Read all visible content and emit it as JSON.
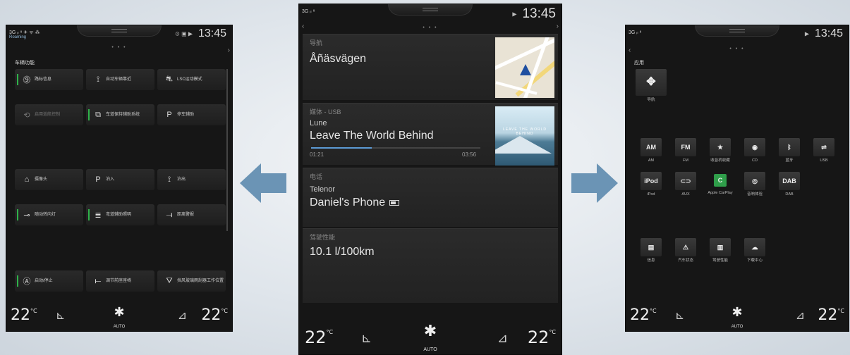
{
  "colors": {
    "accent_green": "#2fb34a",
    "arrow_blue": "#6b94b5",
    "progress_blue": "#5c9bd5"
  },
  "left_screen": {
    "status": {
      "signal": "3G ᵢₗ ⁸ ✈ ᯤ ⁂",
      "sub": "Roaming",
      "icons": "⊙ ▣ ▶",
      "clock": "13:45"
    },
    "page_dots": "• • •",
    "title": "车辆功能",
    "functions": [
      {
        "icon": "⓽",
        "label": "路标信息",
        "active": true,
        "dim": false
      },
      {
        "icon": "⟟",
        "label": "自动车辆靠近",
        "active": false,
        "dim": false
      },
      {
        "icon": "⛐",
        "label": "LSC运动模式",
        "active": false,
        "dim": false
      },
      {
        "icon": "⟲",
        "label": "启用巡航控制",
        "active": false,
        "dim": true
      },
      {
        "icon": "⧉",
        "label": "车道保持辅助系统",
        "active": true,
        "dim": false
      },
      {
        "icon": "P",
        "label": "停车辅助",
        "active": false,
        "dim": false
      },
      {
        "icon": "⌂",
        "label": "摄像头",
        "active": false,
        "dim": false
      },
      {
        "icon": "P",
        "label": "泊入",
        "active": false,
        "dim": false
      },
      {
        "icon": "⟟",
        "label": "泊出",
        "active": false,
        "dim": false
      },
      {
        "icon": "⊸",
        "label": "随动转向灯",
        "active": true,
        "dim": false
      },
      {
        "icon": "≣",
        "label": "弯道辅助照明",
        "active": true,
        "dim": false
      },
      {
        "icon": "⟞",
        "label": "距离警报",
        "active": false,
        "dim": false
      },
      {
        "icon": "Ⓐ",
        "label": "启动/停止",
        "active": true,
        "dim": false
      },
      {
        "icon": "⟝",
        "label": "调节前座座椅",
        "active": false,
        "dim": false
      },
      {
        "icon": "⛛",
        "label": "挡风玻璃雨刮器工作位置",
        "active": false,
        "dim": false
      }
    ],
    "climate": {
      "left_temp": "22",
      "right_temp": "22",
      "unit": "°C",
      "auto": "AUTO",
      "seat_left": "⊾",
      "seat_right": "⊿",
      "fan": "✱"
    }
  },
  "center_screen": {
    "status": {
      "signal": "3G ᵢₗ ⁸",
      "icons": "▶",
      "clock": "13:45"
    },
    "page_dots": "• • •",
    "navigation": {
      "header": "导航",
      "street": "Åñäsvägen"
    },
    "media": {
      "header": "媒体 - USB",
      "artist": "Lune",
      "track": "Leave The World Behind",
      "elapsed": "01:21",
      "duration": "03:56",
      "progress": 0.36,
      "album_text": "LEAVE THE WORLD BEHIND"
    },
    "phone": {
      "header": "电话",
      "carrier": "Telenor",
      "device": "Daniel's Phone"
    },
    "driving": {
      "header": "驾驶性能",
      "consumption": "10.1 l/100km"
    },
    "climate": {
      "left_temp": "22",
      "right_temp": "22",
      "unit": "°C",
      "auto": "AUTO",
      "seat_left": "⊾",
      "seat_right": "⊿",
      "fan": "✱"
    }
  },
  "right_screen": {
    "status": {
      "signal": "3G ᵢₗ ⁸",
      "icons": "▶",
      "clock": "13:45"
    },
    "page_dots": "• • •",
    "title": "应用",
    "nav_app": {
      "icon": "✥",
      "label": "导航"
    },
    "apps_row1": [
      {
        "icon": "AM",
        "label": "AM"
      },
      {
        "icon": "FM",
        "label": "FM"
      },
      {
        "icon": "★",
        "label": "收音机收藏"
      },
      {
        "icon": "◉",
        "label": "CD"
      },
      {
        "icon": "ᛒ",
        "label": "蓝牙"
      },
      {
        "icon": "⇌",
        "label": "USB"
      }
    ],
    "apps_row2": [
      {
        "icon": "iPod",
        "label": "iPod"
      },
      {
        "icon": "⊂⊃",
        "label": "AUX"
      },
      {
        "icon": "C",
        "label": "Apple CarPlay"
      },
      {
        "icon": "◎",
        "label": "音响体验"
      },
      {
        "icon": "DAB",
        "label": "DAB"
      }
    ],
    "apps_row3": [
      {
        "icon": "▤",
        "label": "信息"
      },
      {
        "icon": "⚠",
        "label": "汽车状态"
      },
      {
        "icon": "▥",
        "label": "驾驶性能"
      },
      {
        "icon": "☁",
        "label": "下载中心"
      }
    ],
    "climate": {
      "left_temp": "22",
      "right_temp": "22",
      "unit": "°C",
      "auto": "AUTO",
      "seat_left": "⊾",
      "seat_right": "⊿",
      "fan": "✱"
    }
  }
}
